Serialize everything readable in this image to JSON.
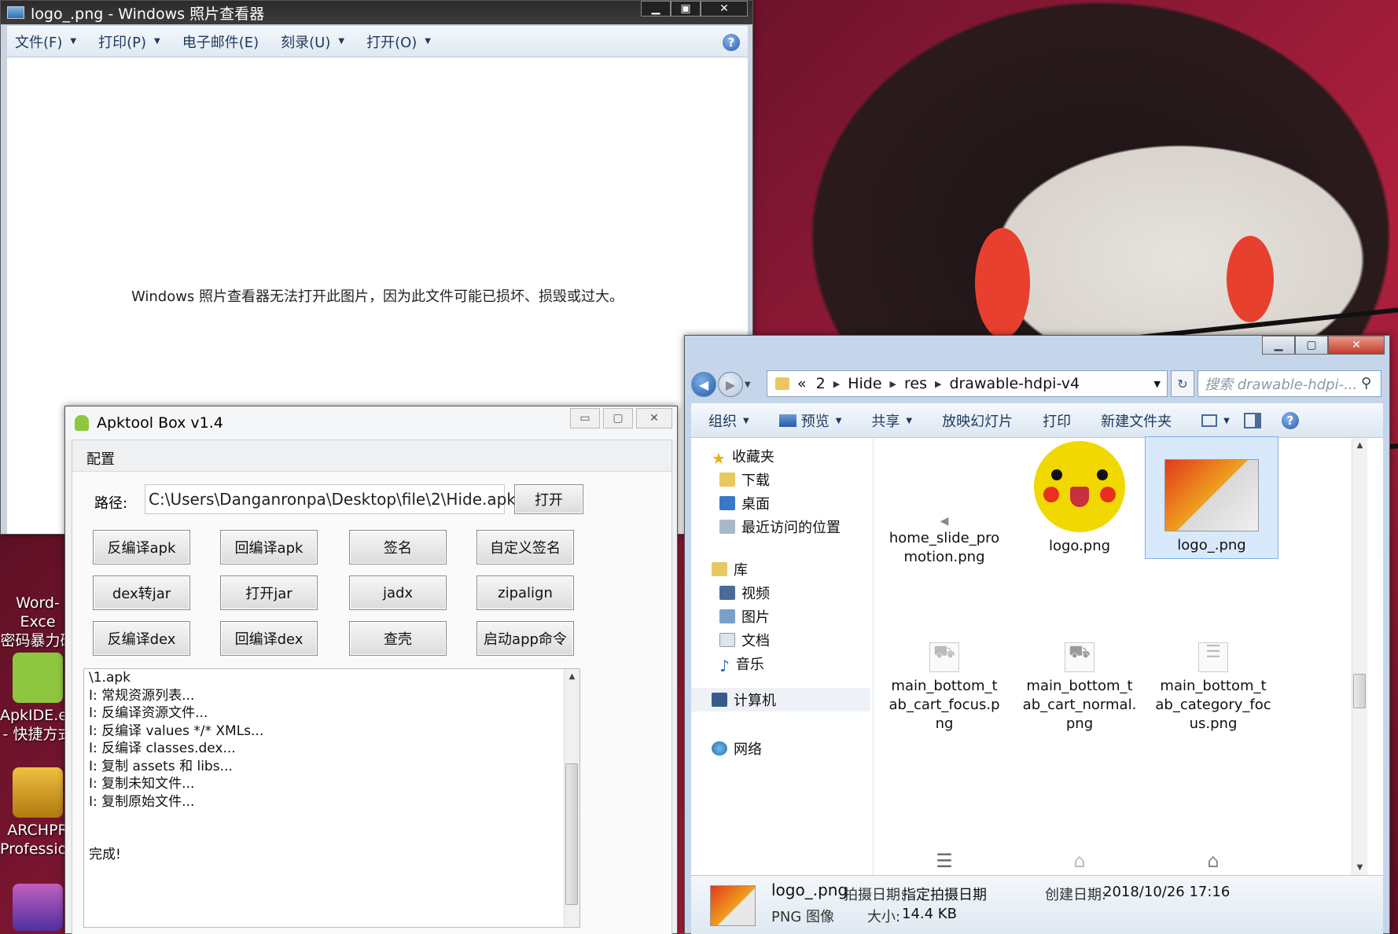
{
  "viewer": {
    "title": "logo_.png - Windows 照片查看器",
    "menu": [
      {
        "label": "文件(F)",
        "has_dropdown": true
      },
      {
        "label": "打印(P)",
        "has_dropdown": true
      },
      {
        "label": "电子邮件(E)",
        "has_dropdown": false
      },
      {
        "label": "刻录(U)",
        "has_dropdown": true
      },
      {
        "label": "打开(O)",
        "has_dropdown": true
      }
    ],
    "help_glyph": "?",
    "message": "Windows 照片查看器无法打开此图片，因为此文件可能已损坏、损毁或过大。"
  },
  "desktop_icons": [
    {
      "label1": "Word-Exce",
      "label2": "密码暴力破"
    },
    {
      "label1": "ApkIDE.ex",
      "label2": "- 快捷方式"
    },
    {
      "label1": "ARCHPR",
      "label2": "Profession"
    }
  ],
  "apktool": {
    "title": "Apktool Box v1.4",
    "menu_config": "配置",
    "path_label": "路径:",
    "path_value": "C:\\Users\\Danganronpa\\Desktop\\file\\2\\Hide.apk",
    "open_label": "打开",
    "buttons": [
      [
        "反编译apk",
        "回编译apk",
        "签名",
        "自定义签名"
      ],
      [
        "dex转jar",
        "打开jar",
        "jadx",
        "zipalign"
      ],
      [
        "反编译dex",
        "回编译dex",
        "查壳",
        "启动app命令"
      ]
    ],
    "log": [
      "\\1.apk",
      "I: 常规资源列表...",
      "I: 反编译资源文件...",
      "I: 反编译 values */* XMLs...",
      "I: 反编译 classes.dex...",
      "I: 复制 assets 和 libs...",
      "I: 复制未知文件...",
      "I: 复制原始文件...",
      "",
      "",
      "完成!"
    ]
  },
  "explorer": {
    "breadcrumb": [
      "«",
      "2",
      "Hide",
      "res",
      "drawable-hdpi-v4"
    ],
    "search_placeholder": "搜索 drawable-hdpi-...",
    "toolbar": [
      {
        "label": "组织",
        "has_dropdown": true
      },
      {
        "label": "预览",
        "has_dropdown": true
      },
      {
        "label": "共享",
        "has_dropdown": true
      },
      {
        "label": "放映幻灯片",
        "has_dropdown": false
      },
      {
        "label": "打印",
        "has_dropdown": false
      },
      {
        "label": "新建文件夹",
        "has_dropdown": false
      }
    ],
    "nav": {
      "favorites": "收藏夹",
      "downloads": "下载",
      "desktop": "桌面",
      "recent": "最近访问的位置",
      "libraries": "库",
      "videos": "视频",
      "pictures": "图片",
      "documents": "文档",
      "music": "音乐",
      "computer": "计算机",
      "network": "网络"
    },
    "files": [
      {
        "name1": "home_slide_pro",
        "name2": "motion.png",
        "name3": ""
      },
      {
        "name1": "logo.png",
        "name2": "",
        "name3": ""
      },
      {
        "name1": "logo_.png",
        "name2": "",
        "name3": ""
      },
      {
        "name1": "main_bottom_t",
        "name2": "ab_cart_focus.p",
        "name3": "ng"
      },
      {
        "name1": "main_bottom_t",
        "name2": "ab_cart_normal.",
        "name3": "png"
      },
      {
        "name1": "main_bottom_t",
        "name2": "ab_category_foc",
        "name3": "us.png"
      }
    ],
    "details": {
      "filename": "logo_.png",
      "type": "PNG 图像",
      "date_taken_label": "拍摄日期:",
      "date_taken_value": "指定拍摄日期",
      "size_label": "大小:",
      "size_value": "14.4 KB",
      "created_label": "创建日期:",
      "created_value": "2018/10/26 17:16"
    }
  },
  "colors": {
    "accent": "#1e395b",
    "selection": "#d7e9fb"
  }
}
